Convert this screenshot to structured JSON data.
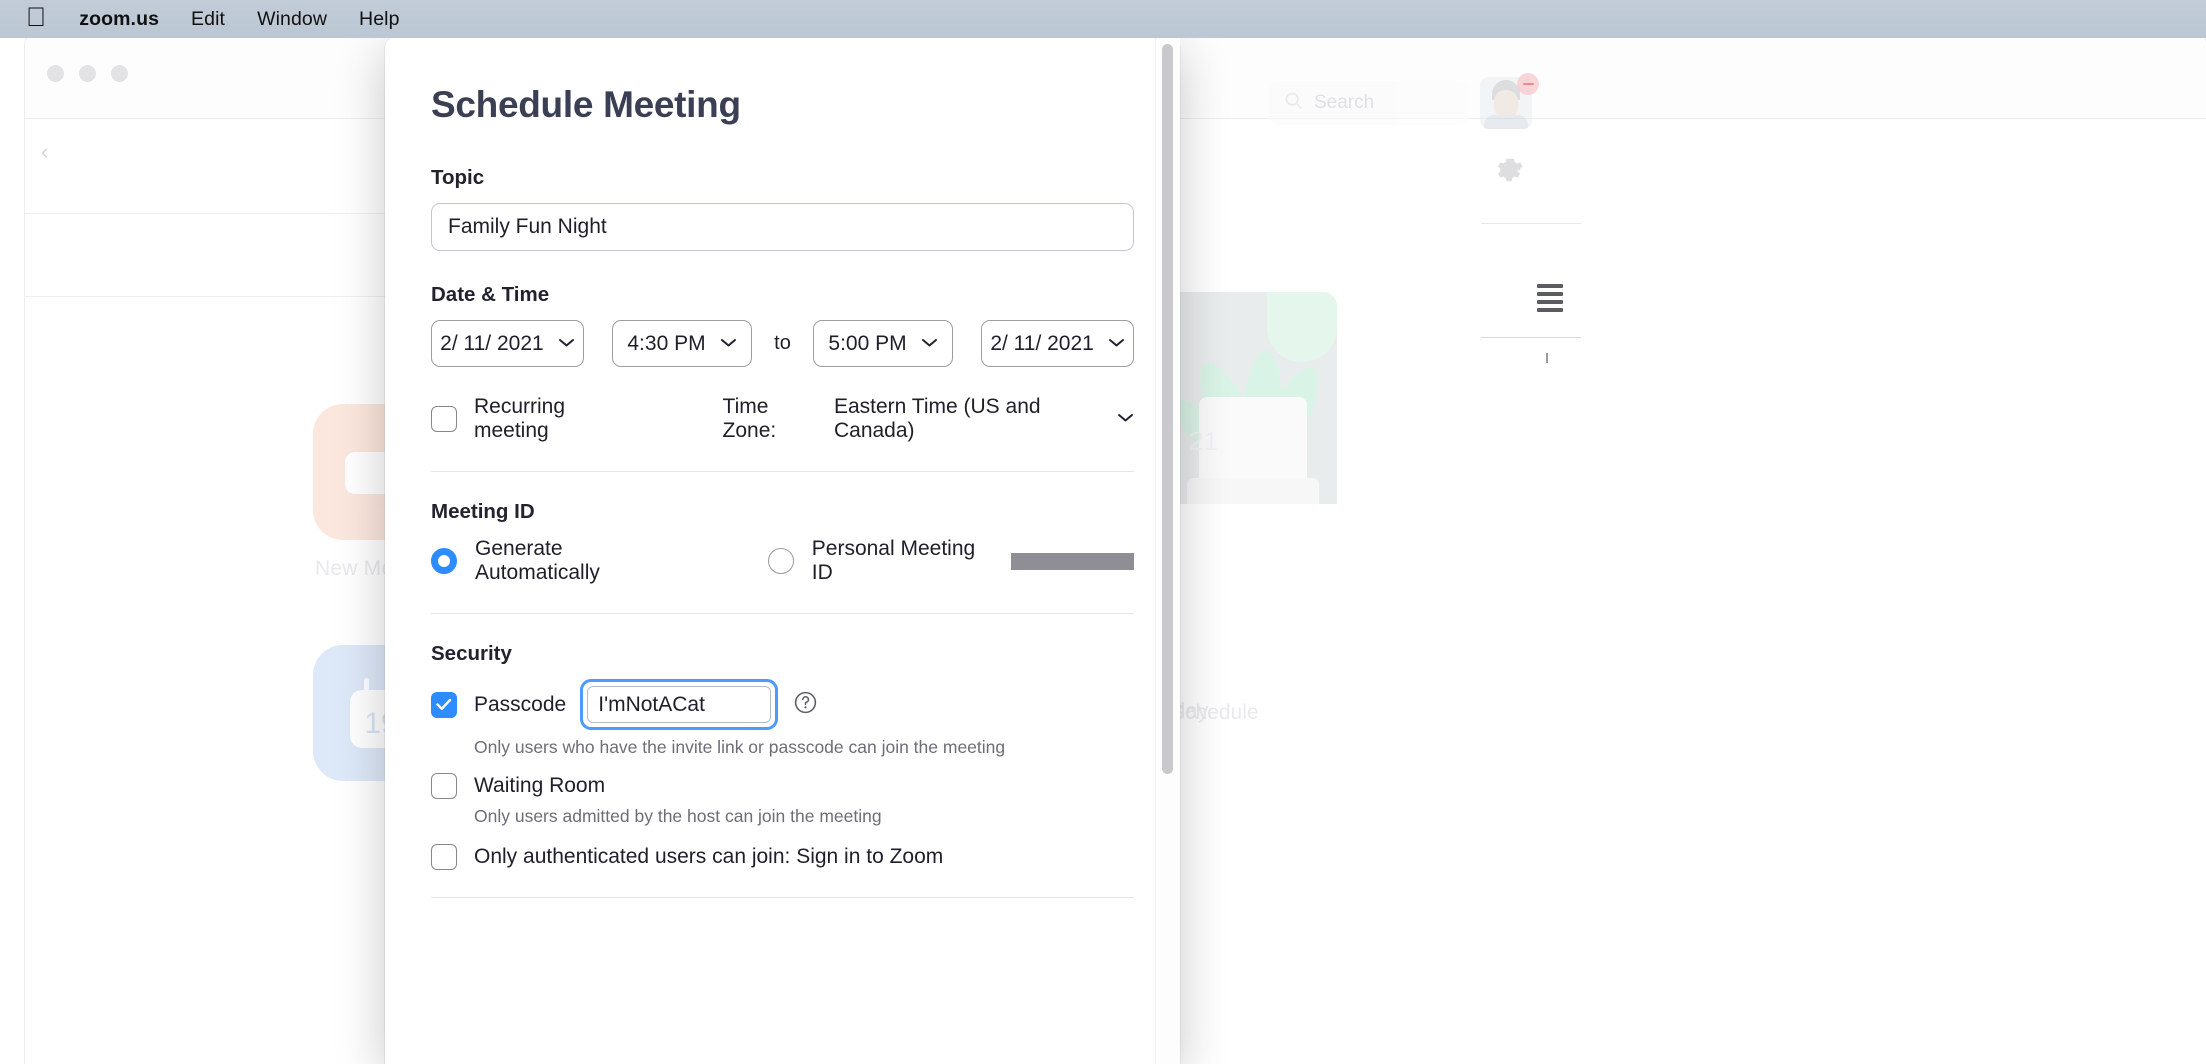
{
  "menubar": {
    "apple_glyph": "",
    "items": [
      {
        "label": "zoom.us",
        "bold": true
      },
      {
        "label": "Edit",
        "bold": false
      },
      {
        "label": "Window",
        "bold": false
      },
      {
        "label": "Help",
        "bold": false
      }
    ]
  },
  "app_window": {
    "search_placeholder": "Search",
    "new_meeting_label": "New Meeting",
    "schedule_label": "Schedule",
    "plant_year": "21",
    "meeting_day": "day"
  },
  "dialog": {
    "title": "Schedule Meeting",
    "topic": {
      "label": "Topic",
      "value": "Family Fun Night"
    },
    "datetime": {
      "label": "Date & Time",
      "start_date": "2/ 11/ 2021",
      "start_time": "4:30 PM",
      "to": "to",
      "end_time": "5:00 PM",
      "end_date": "2/ 11/ 2021",
      "recurring_label": "Recurring meeting",
      "recurring_checked": false,
      "timezone_label": "Time Zone:",
      "timezone_value": "Eastern Time (US and Canada)"
    },
    "meeting_id": {
      "label": "Meeting ID",
      "generate_label": "Generate Automatically",
      "generate_selected": true,
      "personal_label": "Personal Meeting ID",
      "personal_value_redacted": "",
      "personal_selected": false
    },
    "security": {
      "label": "Security",
      "passcode_label": "Passcode",
      "passcode_checked": true,
      "passcode_value": "I'mNotACat",
      "passcode_help_icon": "question-mark",
      "passcode_hint": "Only users who have the invite link or passcode can join the meeting",
      "waiting_room_label": "Waiting Room",
      "waiting_room_checked": false,
      "waiting_room_hint": "Only users admitted by the host can join the meeting",
      "authenticated_label": "Only authenticated users can join: Sign in to Zoom",
      "authenticated_checked": false
    }
  },
  "colors": {
    "accent_blue": "#2d8cff",
    "focus_ring": "#4d9bff",
    "title_navy": "#3b3f54",
    "text_dark": "#1e1f2a",
    "hint_gray": "#6d6d78",
    "menubar_bg": "#bfc9d6",
    "tile_new_meeting": "#fbe3d8",
    "tile_schedule": "#d6e4f7",
    "redaction_gray": "#8e8e94"
  }
}
